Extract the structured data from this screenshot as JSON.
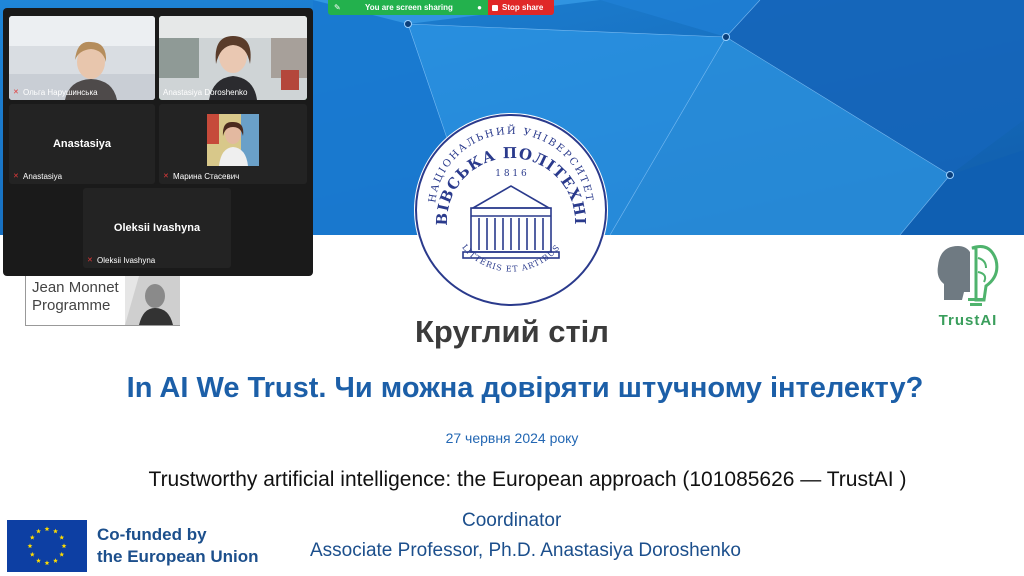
{
  "sharing_bar": {
    "status_text": "You are screen sharing",
    "stop_label": "Stop share",
    "colors": {
      "bar": "#23b14d",
      "stop": "#e02828"
    }
  },
  "participants": [
    {
      "name": "Ольга Нарушинська",
      "has_video": true,
      "muted": true
    },
    {
      "name": "Anastasiya Doroshenko",
      "has_video": true,
      "muted": false,
      "active_speaker": true
    },
    {
      "name": "Anastasiya",
      "display_name": "Anastasiya",
      "has_video": false,
      "muted": true
    },
    {
      "name": "Марина Стасевич",
      "has_video": true,
      "muted": true
    },
    {
      "name": "Oleksii Ivashyna",
      "display_name": "Oleksii Ivashyna",
      "has_video": false,
      "muted": true
    }
  ],
  "logos": {
    "university_text_top": "НАЦІОНАЛЬНИЙ УНІВЕРСИТЕТ",
    "university_text_main": "ЛЬВІВСЬКА ПОЛІТЕХНІКА",
    "university_year": "1 8 1 6",
    "university_motto": "LITTERIS ET ARTIBUS",
    "jean_monnet_line1": "Jean Monnet",
    "jean_monnet_line2": "Programme",
    "trustai_label": "TrustAI",
    "eu_line1": "Co-funded by",
    "eu_line2": "the European Union"
  },
  "slide": {
    "heading": "Круглий стіл",
    "title": "In AI We Trust. Чи можна довіряти штучному інтелекту?",
    "date": "27 червня 2024 року",
    "project": "Trustworthy artificial intelligence: the European approach (101085626 — TrustAI )",
    "coordinator_label": "Coordinator",
    "coordinator_name": "Associate Professor, Ph.D. Anastasiya Doroshenko"
  },
  "colors": {
    "background_blue": "#1a6fc4",
    "title_blue": "#1c5fa8",
    "trustai_green": "#3a9e5c",
    "eu_blue": "#0d3fa3",
    "eu_star": "#ffdd00",
    "active_speaker": "#2fd15a"
  },
  "icons": [
    "shield-check-icon",
    "stop-square-icon",
    "mic-muted-icon",
    "brain-head-icon",
    "eu-flag-icon"
  ]
}
